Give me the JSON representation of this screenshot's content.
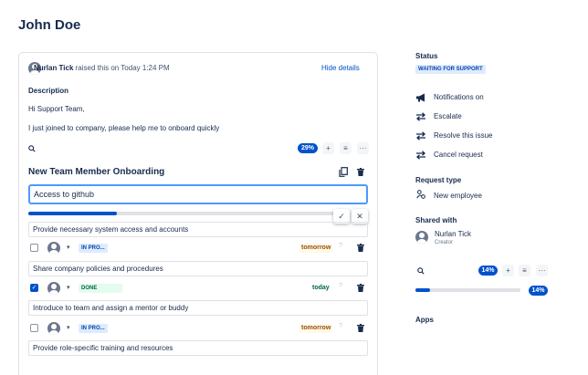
{
  "page": {
    "title": "John Doe"
  },
  "request": {
    "author": "Nurlan Tick",
    "raised_text": " raised this on Today 1:24 PM",
    "hide_details": "Hide details",
    "description_label": "Description",
    "description_lines": [
      "Hi Support Team,",
      "I just joined to company, please help me to onboard quickly"
    ]
  },
  "checklist": {
    "progress_label": "29%",
    "progress": 0.29,
    "title": "New Team Member Onboarding",
    "edit_value": "Access to github",
    "items": [
      {
        "text": "Provide necessary system access and accounts",
        "status": "IN PRO...",
        "done": false,
        "due": "tomorrow"
      },
      {
        "text": "Share company policies and procedures",
        "status": "DONE",
        "done": true,
        "due": "today"
      },
      {
        "text": "Introduce to team and assign a mentor or buddy",
        "status": "IN PRO...",
        "done": false,
        "due": "tomorrow"
      },
      {
        "text": "Provide role-specific training and resources"
      }
    ]
  },
  "sidebar": {
    "status_label": "Status",
    "status_value": "WAITING FOR SUPPORT",
    "actions": [
      "Notifications on",
      "Escalate",
      "Resolve this issue",
      "Cancel request"
    ],
    "request_type_label": "Request type",
    "request_type": "New employee",
    "shared_with_label": "Shared with",
    "shared_user": "Nurlan Tick",
    "shared_role": "Creator",
    "mini_progress_label": "14%",
    "mini_progress": 0.14,
    "apps_label": "Apps"
  },
  "icons": {
    "search": "search-icon",
    "plus": "plus-icon",
    "filter": "filter-icon",
    "more": "more-icon",
    "copy": "copy-icon",
    "trash": "trash-icon",
    "check": "check-icon",
    "close": "close-icon",
    "bell": "megaphone-icon",
    "arrows": "transition-arrows-icon",
    "user": "user-icon"
  },
  "colors": {
    "accent": "#0052cc",
    "focus": "#4c9aff",
    "lozenge_blue_bg": "#deebff",
    "lozenge_green_bg": "#e3fcef",
    "due_yellow_bg": "#fffae6"
  }
}
